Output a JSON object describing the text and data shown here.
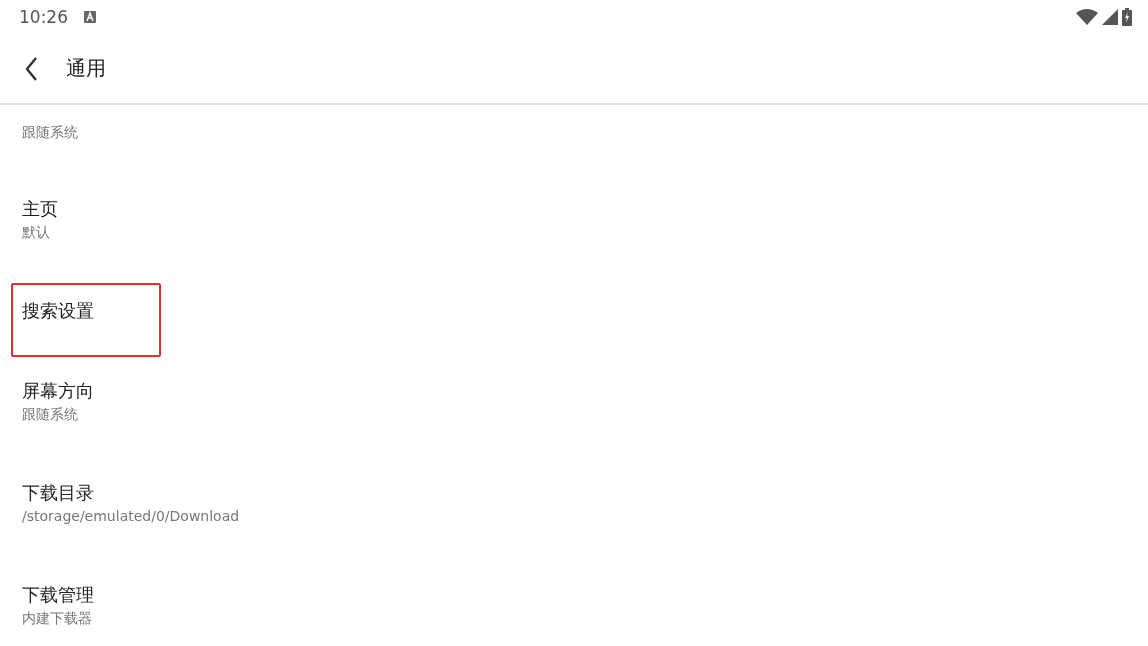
{
  "status_bar": {
    "time": "10:26"
  },
  "header": {
    "title": "通用"
  },
  "items": [
    {
      "subtitle": "跟随系统",
      "highlighted": false
    },
    {
      "title": "主页",
      "subtitle": "默认",
      "highlighted": false
    },
    {
      "title": "搜索设置",
      "highlighted": true
    },
    {
      "title": "屏幕方向",
      "subtitle": "跟随系统",
      "highlighted": false
    },
    {
      "title": "下载目录",
      "subtitle": "/storage/emulated/0/Download",
      "highlighted": false
    },
    {
      "title": "下载管理",
      "subtitle": "内建下载器",
      "highlighted": false
    }
  ]
}
